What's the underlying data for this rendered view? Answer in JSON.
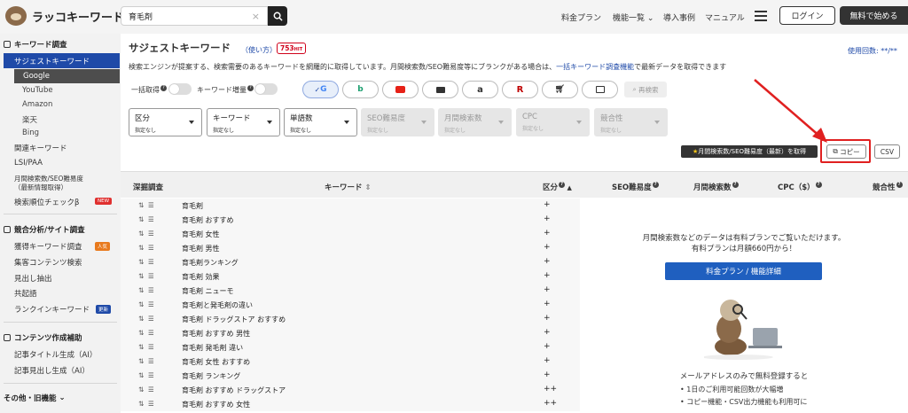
{
  "header": {
    "logo": "ラッコキーワード",
    "search_value": "育毛剤",
    "nav": [
      "料金プラン",
      "機能一覧",
      "導入事例",
      "マニュアル"
    ],
    "login": "ログイン",
    "start": "無料で始める"
  },
  "sidebar": {
    "section1": "キーワード調査",
    "suggest": "サジェストキーワード",
    "engines": [
      "Google",
      "YouTube",
      "Amazon",
      "楽天",
      "Bing"
    ],
    "related": "関連キーワード",
    "lsi": "LSI/PAA",
    "monthly1": "月間検索数/SEO難易度",
    "monthly2": "（最新情報取得）",
    "rank": "検索順位チェックβ",
    "badge_new": "NEW",
    "section2": "競合分析/サイト調査",
    "acquired": "獲得キーワード調査",
    "badge_popular": "人気",
    "content": "集客コンテンツ検索",
    "headings": "見出し抽出",
    "cooccur": "共起語",
    "rankin": "ランクインキーワード",
    "badge_update": "更新",
    "section3": "コンテンツ作成補助",
    "title_gen": "記事タイトル生成（AI）",
    "heading_gen": "記事見出し生成（AI）",
    "section4": "その他・旧機能"
  },
  "main": {
    "title": "サジェストキーワード",
    "howto": "（使い方）",
    "hits": "753",
    "hits_unit": "HIT",
    "usage": "使用回数: **/**",
    "desc_before": "検索エンジンが提案する、検索需要のあるキーワードを網羅的に取得しています。月間検索数/SEO難易度等にブランクがある場合は、",
    "desc_link": "一括キーワード調査機能",
    "desc_after": "で最新データを取得できます",
    "toggle_bulk": "一括取得",
    "toggle_increase": "キーワード増量",
    "rescan": "再検索",
    "filters": [
      {
        "label": "区分",
        "sub": "指定なし"
      },
      {
        "label": "キーワード",
        "sub": "指定なし"
      },
      {
        "label": "単語数",
        "sub": "指定なし"
      },
      {
        "label": "SEO難易度",
        "sub": "指定なし"
      },
      {
        "label": "月間検索数",
        "sub": "指定なし"
      },
      {
        "label": "CPC",
        "sub": "指定なし"
      },
      {
        "label": "競合性",
        "sub": "指定なし"
      }
    ],
    "get_btn": "月間検索数/SEO難易度（最新）を取得",
    "copy_btn": "コピー",
    "csv_btn": "CSV",
    "columns": [
      "深掘調査",
      "キーワード",
      "区分",
      "SEO難易度",
      "月間検索数",
      "CPC（$）",
      "競合性"
    ],
    "rows": [
      {
        "kw": "育毛剤",
        "kbn": "+"
      },
      {
        "kw": "育毛剤 おすすめ",
        "kbn": "+"
      },
      {
        "kw": "育毛剤 女性",
        "kbn": "+"
      },
      {
        "kw": "育毛剤 男性",
        "kbn": "+"
      },
      {
        "kw": "育毛剤ランキング",
        "kbn": "+"
      },
      {
        "kw": "育毛剤 効果",
        "kbn": "+"
      },
      {
        "kw": "育毛剤 ニューモ",
        "kbn": "+"
      },
      {
        "kw": "育毛剤と発毛剤の違い",
        "kbn": "+"
      },
      {
        "kw": "育毛剤 ドラッグストア おすすめ",
        "kbn": "+"
      },
      {
        "kw": "育毛剤 おすすめ 男性",
        "kbn": "+"
      },
      {
        "kw": "育毛剤 発毛剤 違い",
        "kbn": "+"
      },
      {
        "kw": "育毛剤 女性 おすすめ",
        "kbn": "+"
      },
      {
        "kw": "育毛剤 ランキング",
        "kbn": "+"
      },
      {
        "kw": "育毛剤 おすすめ ドラッグストア",
        "kbn": "++"
      },
      {
        "kw": "育毛剤 おすすめ 女性",
        "kbn": "++"
      }
    ],
    "promo": {
      "line1": "月間検索数などのデータは有料プランでご覧いただけます。",
      "line2": "有料プランは月額660円から！",
      "button": "料金プラン / 機能詳細",
      "line3": "メールアドレスのみで無料登録すると",
      "bullet1": "1日のご利用可能回数が大幅増",
      "bullet2": "コピー機能・CSV出力機能も利用可に"
    }
  },
  "colors": {
    "accent": "#1f4aa8",
    "highlight": "#e02020",
    "dark": "#333333"
  }
}
